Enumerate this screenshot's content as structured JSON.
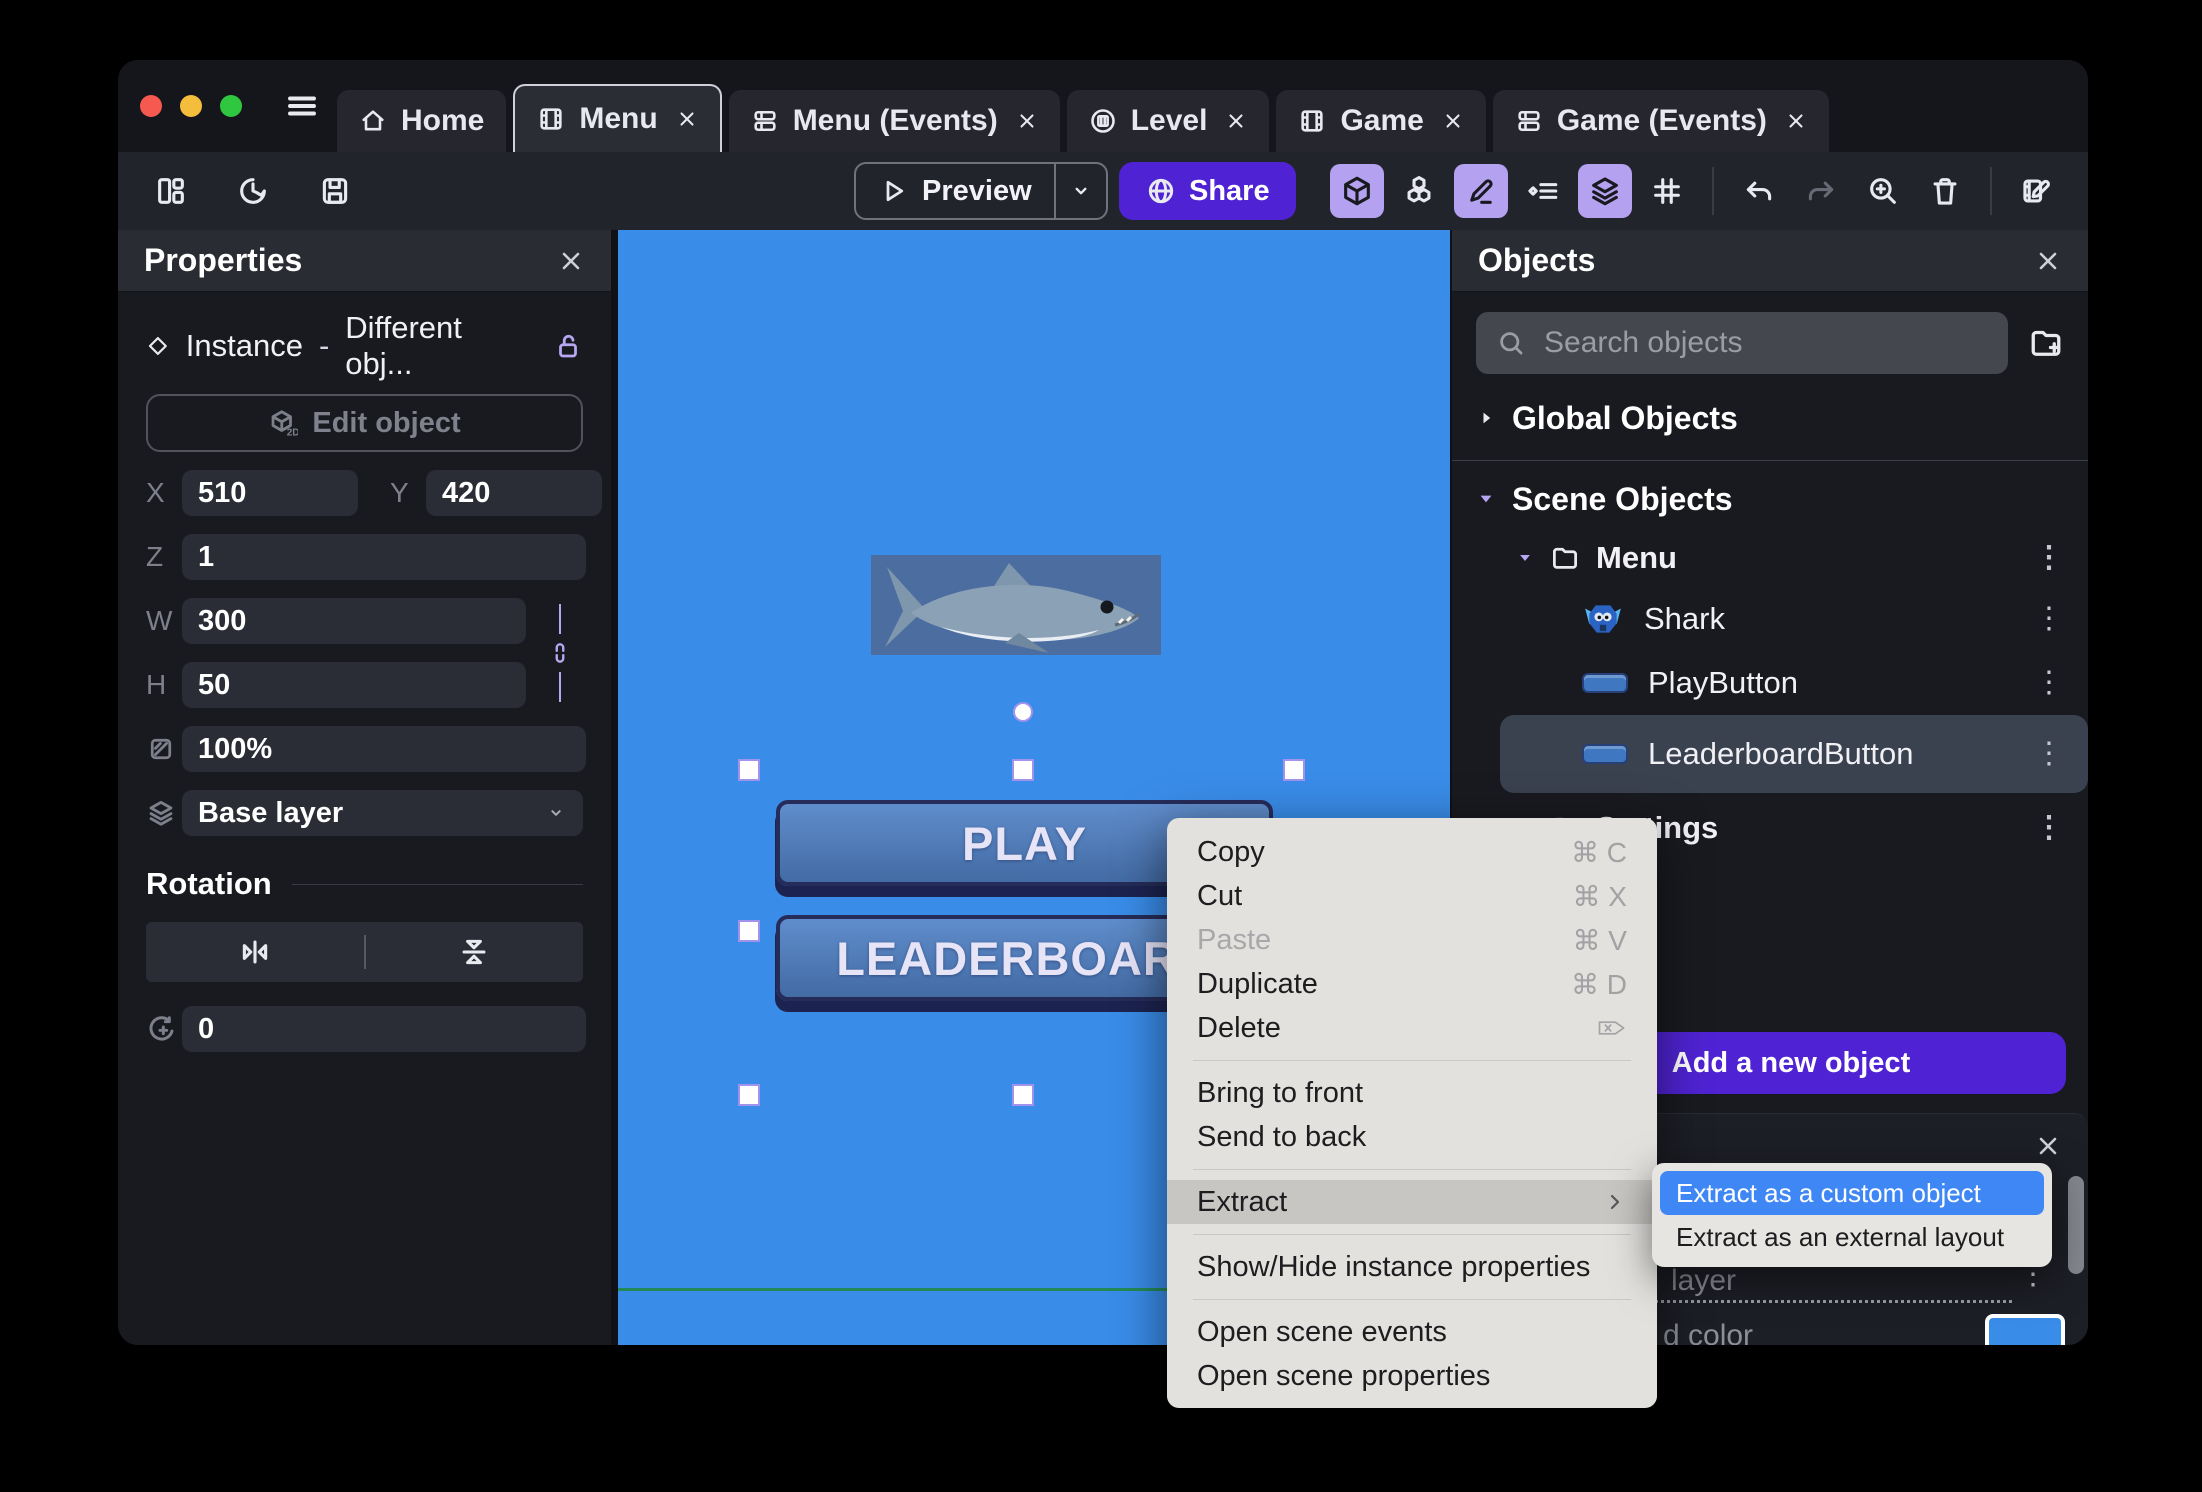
{
  "colors": {
    "accent_purple": "#4F23D3",
    "toolbar_highlight_lavender": "#B4A2F0",
    "canvas_blue": "#398CE8",
    "game_button_blue": "#4A78BA",
    "submenu_selection_blue": "#3E87F5",
    "swatch_blue": "#398CE8",
    "traffic_red": "#F6594F",
    "traffic_yellow": "#F5BD3C",
    "traffic_green": "#30C740"
  },
  "titlebar": {
    "tabs": [
      {
        "label": "Home"
      },
      {
        "label": "Menu"
      },
      {
        "label": "Menu (Events)"
      },
      {
        "label": "Level"
      },
      {
        "label": "Game"
      },
      {
        "label": "Game (Events)"
      }
    ]
  },
  "toolbar": {
    "preview_label": "Preview",
    "share_label": "Share"
  },
  "properties_panel": {
    "title": "Properties",
    "selection_type": "Instance",
    "separator": "-",
    "selection_object": "Different obj...",
    "edit_object_label": "Edit object",
    "x_label": "X",
    "x_value": "510",
    "y_label": "Y",
    "y_value": "420",
    "z_label": "Z",
    "z_value": "1",
    "w_label": "W",
    "w_value": "300",
    "h_label": "H",
    "h_value": "50",
    "opacity_value": "100%",
    "layer_value": "Base layer",
    "rotation_title": "Rotation",
    "rotation_value": "0"
  },
  "canvas": {
    "background_color": "#398CE8",
    "play_label": "PLAY",
    "leaderboard_label": "LEADERBOARD"
  },
  "objects_panel": {
    "title": "Objects",
    "search_placeholder": "Search objects",
    "global_group_label": "Global Objects",
    "scene_group_label": "Scene Objects",
    "folders": [
      {
        "name": "Menu"
      },
      {
        "name": "Settings"
      }
    ],
    "objects": [
      {
        "name": "Shark"
      },
      {
        "name": "PlayButton"
      },
      {
        "name": "LeaderboardButton"
      }
    ],
    "add_object_label": "Add a new object"
  },
  "layers_panel": {
    "base_layer_fragment": "layer",
    "background_color_fragment": "d color",
    "swatch_color": "#398CE8"
  },
  "context_menu": {
    "items": [
      {
        "label": "Copy",
        "shortcut": "⌘ C"
      },
      {
        "label": "Cut",
        "shortcut": "⌘ X"
      },
      {
        "label": "Paste",
        "shortcut": "⌘ V"
      },
      {
        "label": "Duplicate",
        "shortcut": "⌘ D"
      },
      {
        "label": "Delete"
      },
      {
        "label": "Bring to front"
      },
      {
        "label": "Send to back"
      },
      {
        "label": "Extract"
      },
      {
        "label": "Show/Hide instance properties"
      },
      {
        "label": "Open scene events"
      },
      {
        "label": "Open scene properties"
      }
    ],
    "submenu_items": [
      {
        "label": "Extract as a custom object"
      },
      {
        "label": "Extract as an external layout"
      }
    ]
  }
}
